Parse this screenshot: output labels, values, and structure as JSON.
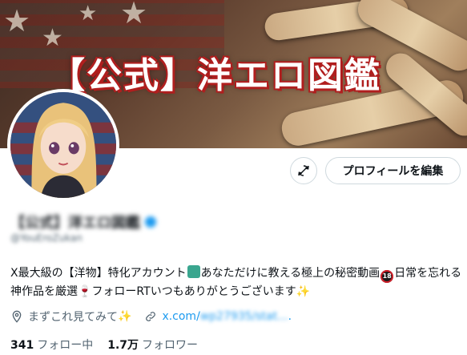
{
  "banner": {
    "title": "【公式】洋エロ図鑑"
  },
  "actions": {
    "edit_profile_label": "プロフィールを編集"
  },
  "profile": {
    "display_name": "【公式】洋エロ図鑑",
    "handle": "@YouEroZukan"
  },
  "bio": {
    "part1": "X最大級の【洋物】特化アカウント",
    "part2": "あなただけに教える極上の秘密動画",
    "part3": "日常を忘れる神作品を厳選",
    "part4": "フォローRTいつもありがとうございます",
    "emoji_18_text": "18"
  },
  "meta": {
    "location": "まずこれ見てみて",
    "link_visible": "x.com/",
    "link_blurred": "wp27935/stat...",
    "link_suffix": "."
  },
  "counts": {
    "following_value": "341",
    "following_label": "フォロー中",
    "followers_value": "1.7万",
    "followers_label": "フォロワー"
  },
  "colors": {
    "accent": "#1d9bf0",
    "text": "#0f1419",
    "secondary_text": "#536471",
    "border": "#cfd9de"
  }
}
